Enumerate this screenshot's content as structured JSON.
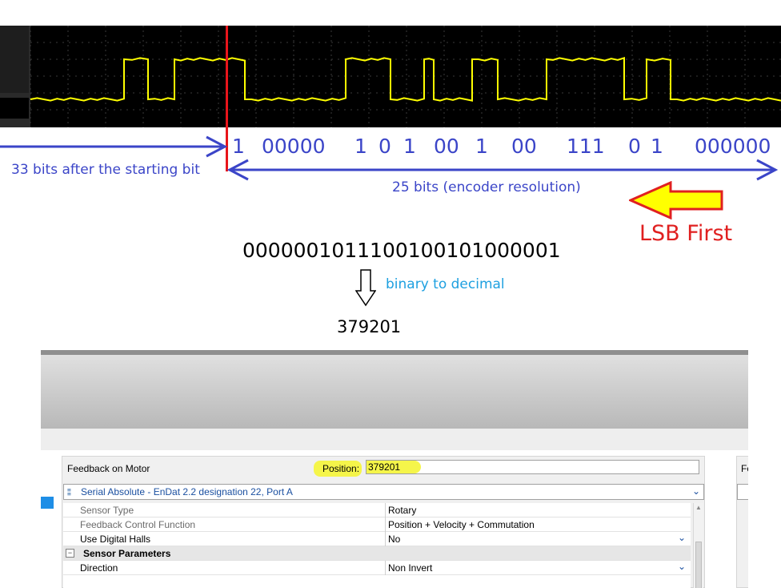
{
  "annotations": {
    "bit_sequence": [
      "1",
      "00000",
      "1",
      "0",
      "1",
      "00",
      "1",
      "00",
      "111",
      "0",
      "1",
      "000000"
    ],
    "start_bits_label": "33 bits after the starting bit",
    "resolution_label": "25 bits (encoder resolution)",
    "lsb_label": "LSB First",
    "binary_value": "0000001011100100101000001",
    "conversion_label": "binary to decimal",
    "decimal_value": "379201",
    "colors": {
      "annotation_blue": "#3b45c8",
      "cursor_red": "#e8151b",
      "lsb_red": "#e02020",
      "arrow_yellow": "#ffff00",
      "conversion_cyan": "#1ea0e0",
      "signal_yellow": "#ffff00"
    }
  },
  "ui": {
    "feedback": {
      "section_title": "Feedback on Motor",
      "position_label": "Position:",
      "position_value": "379201",
      "feedback_type": "Serial Absolute - EnDat 2.2 designation 22, Port A",
      "feedback_type_icon": "list-icon",
      "rows": [
        {
          "name": "Sensor Type",
          "value": "Rotary"
        },
        {
          "name": "Feedback Control Function",
          "value": "Position + Velocity + Commutation"
        },
        {
          "name": "Use Digital Halls",
          "value": "No"
        }
      ],
      "subsection_title": "Sensor Parameters",
      "subsection_toggle": "−",
      "direction_row": {
        "name": "Direction",
        "value": "Non Invert"
      }
    },
    "right_panel_title": "Fe"
  }
}
